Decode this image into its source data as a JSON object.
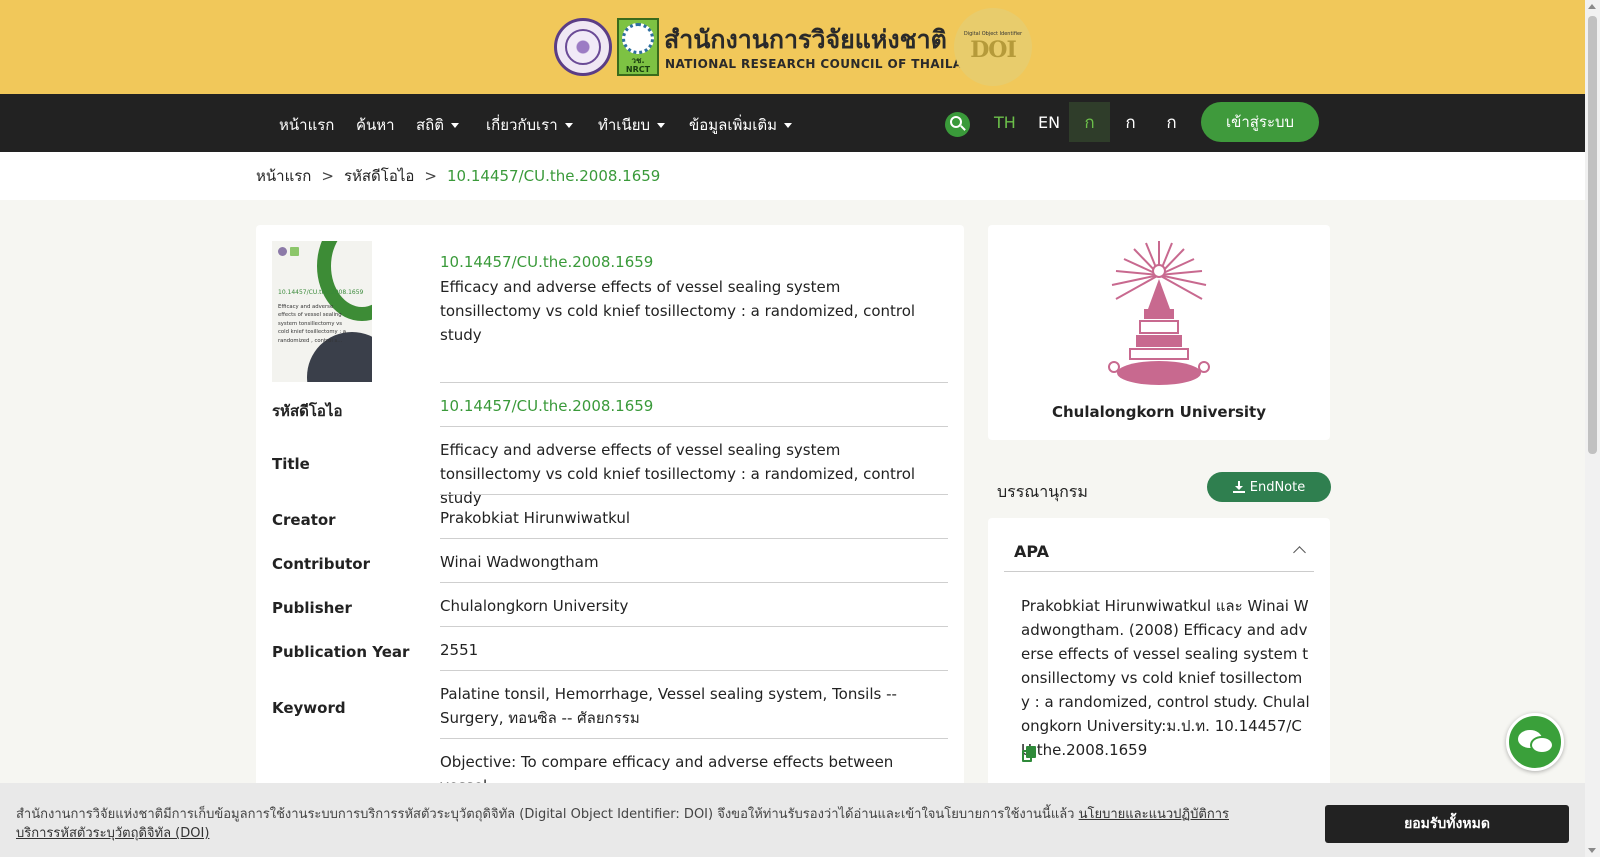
{
  "header": {
    "org_name_th": "สำนักงานการวิจัยแห่งชาติ",
    "org_name_en": "NATIONAL RESEARCH COUNCIL OF THAILAND",
    "nrct_logo_text": "วช. NRCT",
    "doi_logo_text": "DOI",
    "doi_logo_caption": "Digital Object Identifier"
  },
  "nav": {
    "items": [
      {
        "label": "หน้าแรก"
      },
      {
        "label": "ค้นหา"
      },
      {
        "label": "สถิติ"
      },
      {
        "label": "เกี่ยวกับเรา"
      },
      {
        "label": "ทำเนียบ"
      },
      {
        "label": "ข้อมูลเพิ่มเติม"
      }
    ],
    "lang_th": "TH",
    "lang_en": "EN",
    "font_sizes": [
      "ก",
      "ก",
      "ก"
    ],
    "login": "เข้าสู่ระบบ",
    "search_icon": "search-icon"
  },
  "breadcrumb": {
    "home": "หน้าแรก",
    "section": "รหัสดีโอไอ",
    "current": "10.14457/CU.the.2008.1659",
    "separator": ">"
  },
  "record": {
    "cover": {
      "doi": "10.14457/CU.the.2008.1659",
      "title": "Efficacy and adverse effects of vessel sealing system tonsillectomy vs cold knief tosillectomy : a randomized , control s..."
    },
    "doi": "10.14457/CU.the.2008.1659",
    "title": "Efficacy and adverse effects of vessel sealing system tonsillectomy vs cold knief tosillectomy : a randomized, control study",
    "fields": [
      {
        "label": "รหัสดีโอไอ",
        "value": "10.14457/CU.the.2008.1659"
      },
      {
        "label": "Title",
        "value": "Efficacy and adverse effects of vessel sealing system tonsillectomy vs cold knief tosillectomy : a randomized, control study"
      },
      {
        "label": "Creator",
        "value": "Prakobkiat Hirunwiwatkul"
      },
      {
        "label": "Contributor",
        "value": "Winai Wadwongtham"
      },
      {
        "label": "Publisher",
        "value": "Chulalongkorn University"
      },
      {
        "label": "Publication Year",
        "value": "2551"
      },
      {
        "label": "Keyword",
        "value": "Palatine tonsil, Hemorrhage, Vessel sealing system, Tonsils -- Surgery, ทอนซิล -- ศัลยกรรม"
      },
      {
        "label": "",
        "value": "Objective: To compare efficacy and adverse effects between vessel"
      }
    ]
  },
  "publisher_card": {
    "name": "Chulalongkorn University"
  },
  "bibliography": {
    "label": "บรรณานุกรม",
    "endnote": "EndNote",
    "style": "APA",
    "citation": "Prakobkiat Hirunwiwatkul และ Winai Wadwongtham. (2008) Efficacy and adverse effects of vessel sealing system tonsillectomy vs cold knief tosillectomy : a randomized, control study. Chulalongkorn University:ม.ป.ท. 10.14457/CU.the.2008.1659"
  },
  "cookie": {
    "text": "สำนักงานการวิจัยแห่งชาติมีการเก็บข้อมูลการใช้งานระบบการบริการรหัสตัวระบุวัตถุดิจิทัล (Digital Object Identifier: DOI) จึงขอให้ท่านรับรองว่าได้อ่านและเข้าใจนโยบายการใช้งานนี้แล้ว",
    "policy_link": "นโยบายและแนวปฏิบัติการบริการรหัสตัวระบุวัตถุดิจิทัล (DOI)",
    "accept": "ยอมรับทั้งหมด"
  },
  "colors": {
    "header_bg": "#f1c85a",
    "nav_bg": "#222222",
    "accent_green": "#3a9a3a",
    "emblem_pink": "#c8698f"
  }
}
